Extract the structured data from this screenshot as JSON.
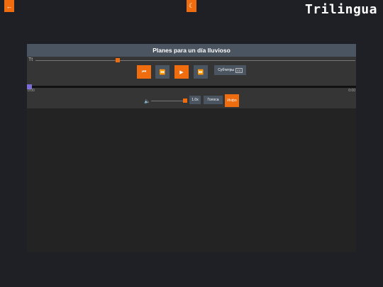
{
  "header": {
    "back_icon": "arrow-left-icon",
    "theme_icon": "moon-icon",
    "logo_text": "Trilingua"
  },
  "player": {
    "title": "Planes para un día lluvioso",
    "font_size_icon": "text-size-icon",
    "font_size_level": 0.25,
    "controls": {
      "prev_icon": "skip-previous-icon",
      "rewind_icon": "rewind-icon",
      "play_icon": "play-icon",
      "forward_icon": "fast-forward-icon"
    },
    "subtitles_label": "Субтитры",
    "subtitles_badge": "CC",
    "progress": {
      "current": "0:00",
      "duration": "0:00",
      "fraction": 0
    },
    "volume_icon": "volume-icon",
    "volume_level": 1.0,
    "speed_label": "1.0x",
    "tracks_label": "Голоса",
    "info_label": "Инфо"
  },
  "colors": {
    "accent": "#ef6c0f",
    "header_bar": "#4a5561",
    "progress_thumb": "#7b6cd9",
    "background": "#1f1f26"
  }
}
